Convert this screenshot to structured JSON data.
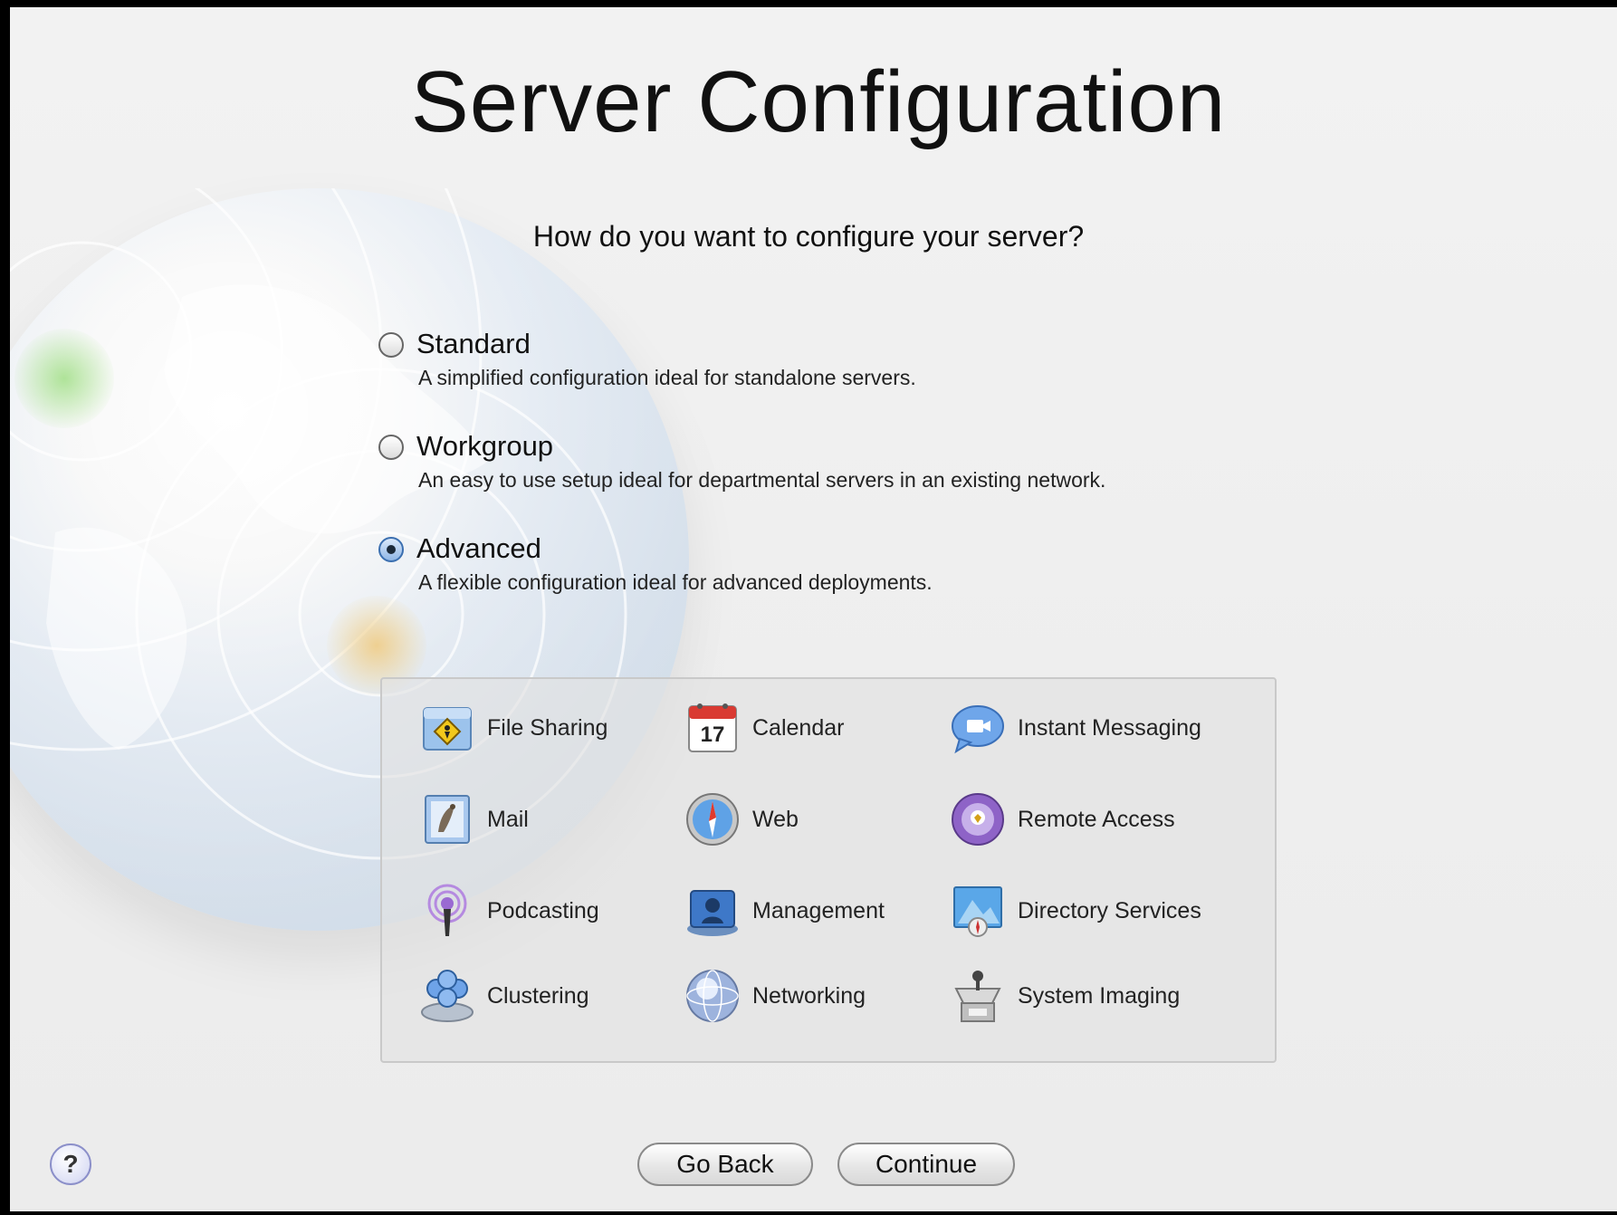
{
  "window": {
    "title": "Server Configuration",
    "question": "How do you want to configure your server?"
  },
  "options": [
    {
      "label": "Standard",
      "description": "A simplified configuration ideal for standalone servers.",
      "selected": false
    },
    {
      "label": "Workgroup",
      "description": "An easy to use setup ideal for departmental servers in an existing network.",
      "selected": false
    },
    {
      "label": "Advanced",
      "description": "A flexible configuration ideal for advanced deployments.",
      "selected": true
    }
  ],
  "services": [
    {
      "label": "File Sharing",
      "icon": "file-sharing-icon"
    },
    {
      "label": "Calendar",
      "icon": "calendar-icon",
      "icon_text": "17"
    },
    {
      "label": "Instant Messaging",
      "icon": "instant-messaging-icon"
    },
    {
      "label": "Mail",
      "icon": "mail-icon"
    },
    {
      "label": "Web",
      "icon": "web-icon"
    },
    {
      "label": "Remote Access",
      "icon": "remote-access-icon"
    },
    {
      "label": "Podcasting",
      "icon": "podcasting-icon"
    },
    {
      "label": "Management",
      "icon": "management-icon"
    },
    {
      "label": "Directory Services",
      "icon": "directory-services-icon"
    },
    {
      "label": "Clustering",
      "icon": "clustering-icon"
    },
    {
      "label": "Networking",
      "icon": "networking-icon"
    },
    {
      "label": "System Imaging",
      "icon": "system-imaging-icon"
    }
  ],
  "buttons": {
    "go_back": "Go Back",
    "continue": "Continue",
    "help": "?"
  }
}
